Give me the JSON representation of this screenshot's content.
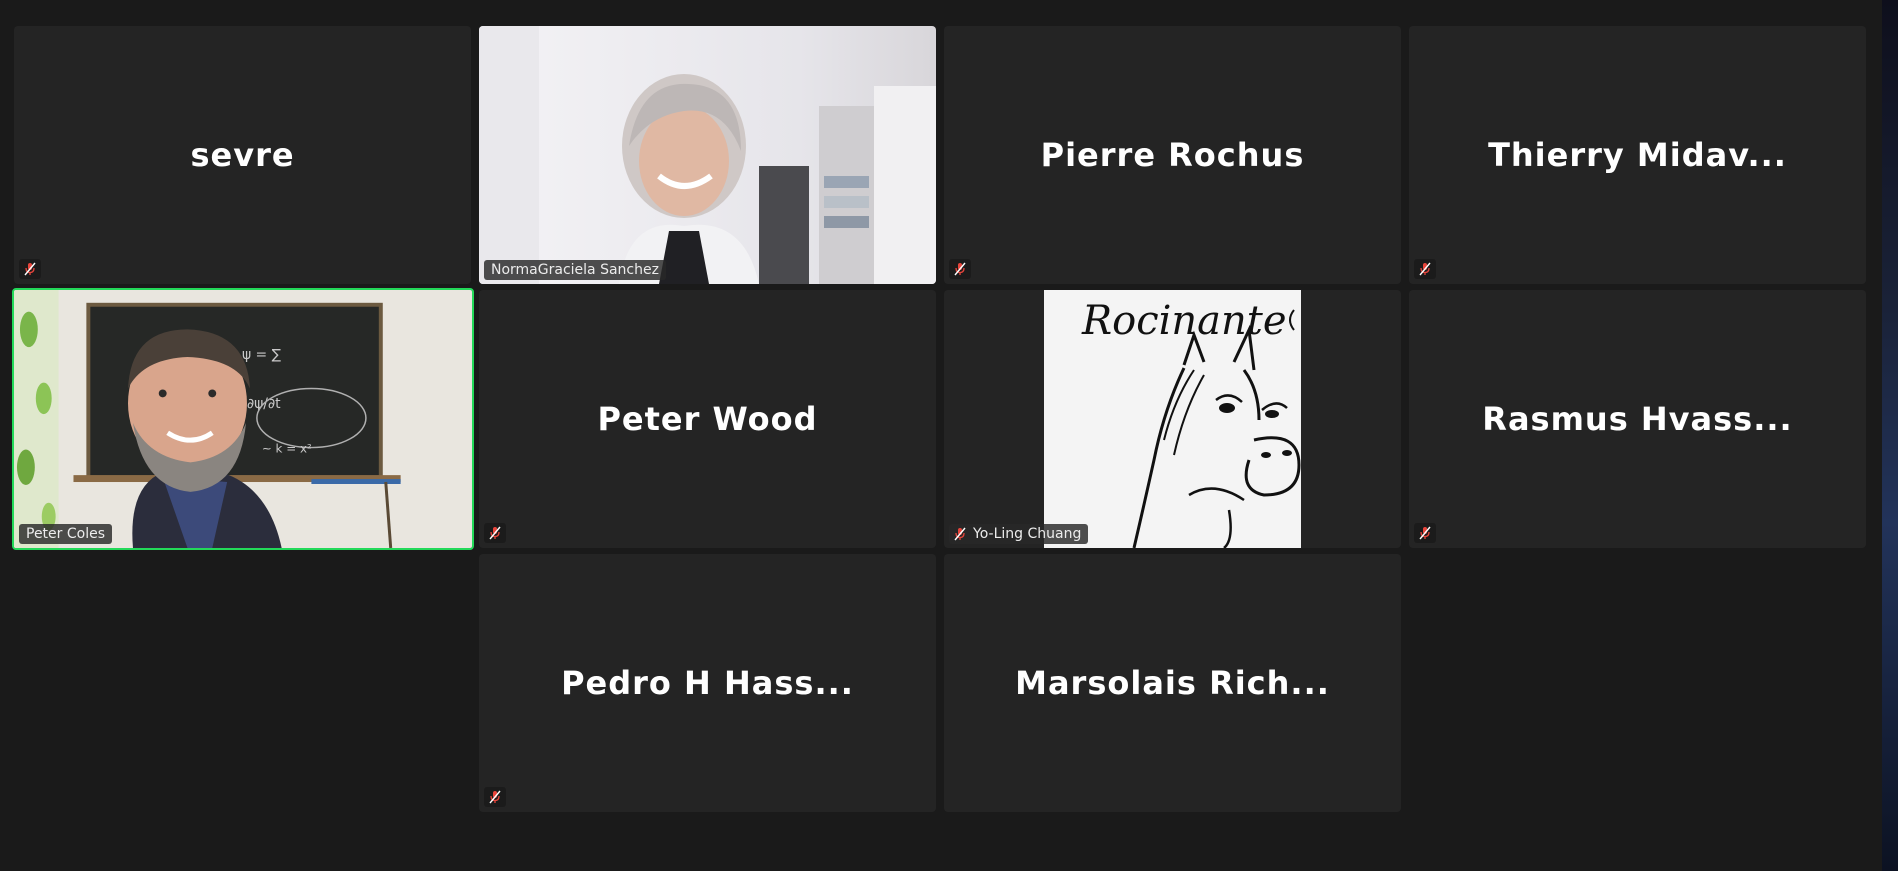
{
  "participants": [
    {
      "name": "sevre",
      "muted": true
    },
    {
      "name": "NormaGraciela Sanchez",
      "muted": false,
      "video": true
    },
    {
      "name": "Pierre Rochus",
      "muted": true
    },
    {
      "name": "Thierry Midav...",
      "muted": true
    },
    {
      "name": "Peter Coles",
      "muted": false,
      "video": true,
      "speaking": true
    },
    {
      "name": "Peter Wood",
      "muted": true
    },
    {
      "name": "Yo-Ling Chuang",
      "muted": true,
      "video": true,
      "video_text": "Rocinante"
    },
    {
      "name": "Rasmus Hvass...",
      "muted": true
    },
    {
      "name": "Pedro H Hass...",
      "muted": true
    },
    {
      "name": "Marsolais Rich...",
      "muted": false
    }
  ],
  "colors": {
    "background": "#1a1a1a",
    "tile": "#242424",
    "active_speaker_border": "#23d959",
    "muted_icon": "#e8453c"
  },
  "icons": {
    "muted": "microphone-muted-icon"
  }
}
